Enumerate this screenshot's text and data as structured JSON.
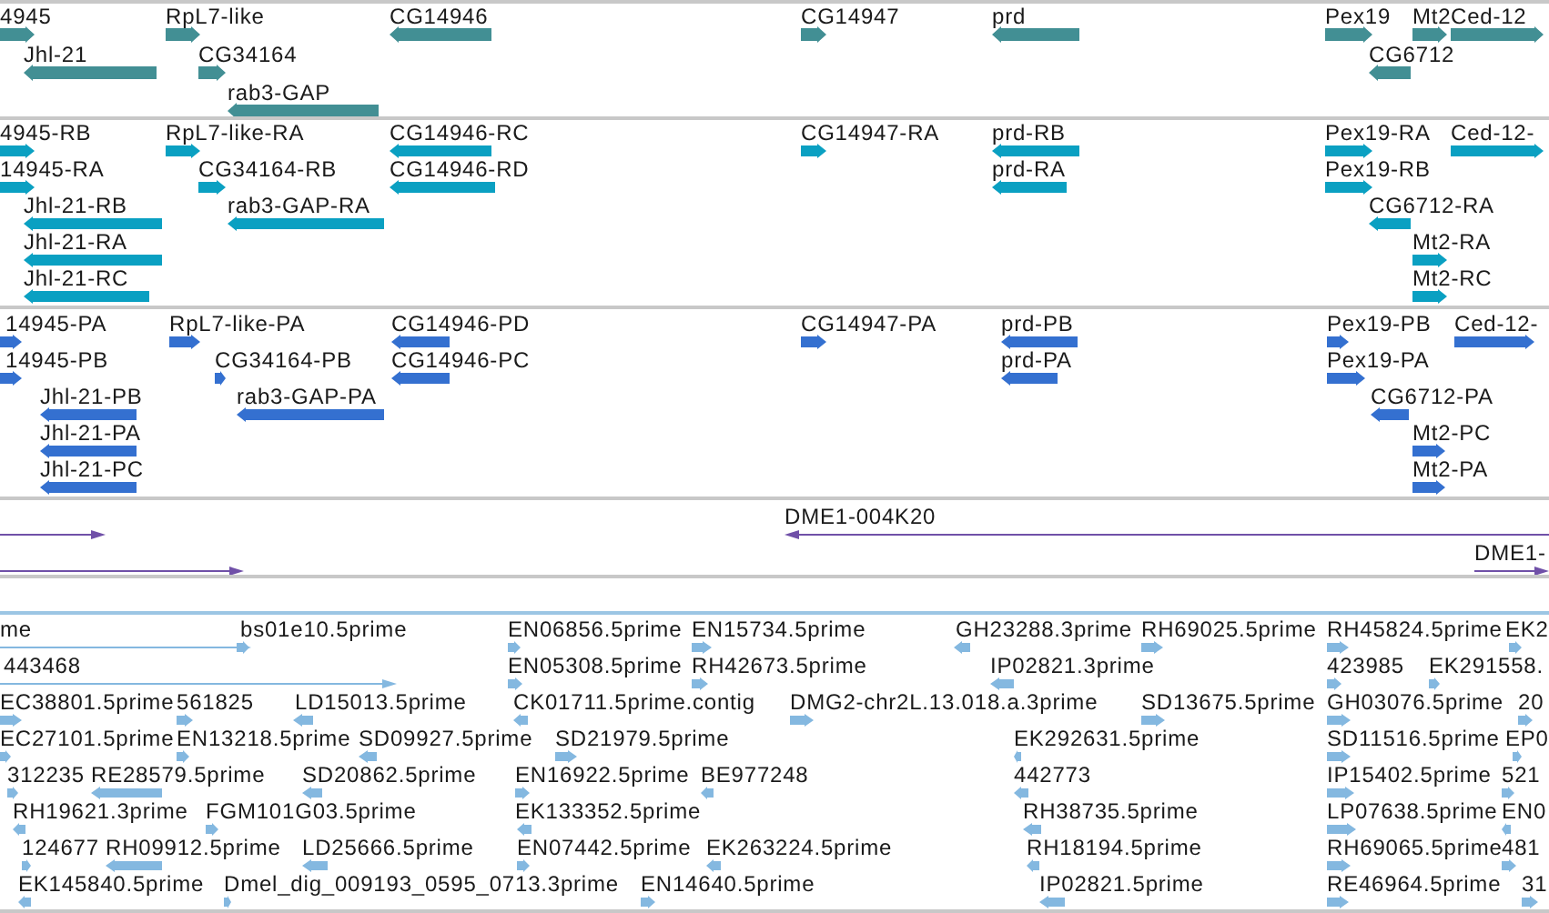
{
  "tracks": [
    {
      "kind": "genes",
      "features": [
        {
          "label": "4945",
          "reverse": false
        },
        {
          "label": "RpL7-like",
          "reverse": false
        },
        {
          "label": "CG14946",
          "reverse": true
        },
        {
          "label": "CG14947",
          "reverse": false
        },
        {
          "label": "prd",
          "reverse": true
        },
        {
          "label": "Pex19",
          "reverse": false
        },
        {
          "label": "Mt2",
          "reverse": false
        },
        {
          "label": "Ced-12",
          "reverse": false
        },
        {
          "label": "Jhl-21",
          "reverse": true
        },
        {
          "label": "CG34164",
          "reverse": false
        },
        {
          "label": "CG6712",
          "reverse": true
        },
        {
          "label": "rab3-GAP",
          "reverse": true
        }
      ]
    },
    {
      "kind": "transcripts",
      "features": [
        {
          "label": "4945-RB",
          "reverse": false
        },
        {
          "label": "RpL7-like-RA",
          "reverse": false
        },
        {
          "label": "CG14946-RC",
          "reverse": true
        },
        {
          "label": "CG14947-RA",
          "reverse": false
        },
        {
          "label": "prd-RB",
          "reverse": true
        },
        {
          "label": "Pex19-RA",
          "reverse": false
        },
        {
          "label": "Ced-12-",
          "reverse": false
        },
        {
          "label": "14945-RA",
          "reverse": false
        },
        {
          "label": "CG34164-RB",
          "reverse": false
        },
        {
          "label": "CG14946-RD",
          "reverse": true
        },
        {
          "label": "prd-RA",
          "reverse": true
        },
        {
          "label": "Pex19-RB",
          "reverse": false
        },
        {
          "label": "Jhl-21-RB",
          "reverse": true
        },
        {
          "label": "rab3-GAP-RA",
          "reverse": true
        },
        {
          "label": "CG6712-RA",
          "reverse": true
        },
        {
          "label": "Jhl-21-RA",
          "reverse": true
        },
        {
          "label": "Mt2-RA",
          "reverse": false
        },
        {
          "label": "Jhl-21-RC",
          "reverse": true
        },
        {
          "label": "Mt2-RC",
          "reverse": false
        }
      ]
    },
    {
      "kind": "proteins",
      "features": [
        {
          "label": "14945-PA",
          "reverse": false
        },
        {
          "label": "RpL7-like-PA",
          "reverse": false
        },
        {
          "label": "CG14946-PD",
          "reverse": true
        },
        {
          "label": "CG14947-PA",
          "reverse": false
        },
        {
          "label": "prd-PB",
          "reverse": true
        },
        {
          "label": "Pex19-PB",
          "reverse": false
        },
        {
          "label": "Ced-12-",
          "reverse": false
        },
        {
          "label": "14945-PB",
          "reverse": false
        },
        {
          "label": "CG34164-PB",
          "reverse": false
        },
        {
          "label": "CG14946-PC",
          "reverse": true
        },
        {
          "label": "prd-PA",
          "reverse": true
        },
        {
          "label": "Pex19-PA",
          "reverse": false
        },
        {
          "label": "Jhl-21-PB",
          "reverse": true
        },
        {
          "label": "rab3-GAP-PA",
          "reverse": true
        },
        {
          "label": "CG6712-PA",
          "reverse": true
        },
        {
          "label": "Jhl-21-PA",
          "reverse": true
        },
        {
          "label": "Mt2-PC",
          "reverse": false
        },
        {
          "label": "Jhl-21-PC",
          "reverse": true
        },
        {
          "label": "Mt2-PA",
          "reverse": false
        }
      ]
    },
    {
      "kind": "clones",
      "features": [
        {
          "reverse": false
        },
        {
          "label": "DME1-004K20",
          "reverse": true
        },
        {
          "reverse": false
        },
        {
          "label": "DME1-",
          "reverse": false
        }
      ]
    },
    {
      "kind": "ests",
      "features": [
        {
          "label": "me",
          "reverse": false
        },
        {
          "label": "bs01e10.5prime",
          "reverse": false
        },
        {
          "label": "EN06856.5prime",
          "reverse": false
        },
        {
          "label": "EN15734.5prime",
          "reverse": false
        },
        {
          "label": "GH23288.3prime",
          "reverse": true
        },
        {
          "label": "RH69025.5prime",
          "reverse": false
        },
        {
          "label": "RH45824.5prime",
          "reverse": false
        },
        {
          "label": "EK2",
          "reverse": false
        },
        {
          "label": "443468",
          "reverse": false
        },
        {
          "label": "EN05308.5prime",
          "reverse": false
        },
        {
          "label": "RH42673.5prime",
          "reverse": false
        },
        {
          "label": "IP02821.3prime",
          "reverse": true
        },
        {
          "label": "423985",
          "reverse": false
        },
        {
          "label": "EK291558.",
          "reverse": false
        },
        {
          "label": "EC38801.5prime",
          "reverse": false
        },
        {
          "label": "561825",
          "reverse": false
        },
        {
          "label": "LD15013.5prime",
          "reverse": true
        },
        {
          "label": "CK01711.5prime.contig",
          "reverse": true
        },
        {
          "label": "DMG2-chr2L.13.018.a.3prime",
          "reverse": false
        },
        {
          "label": "SD13675.5prime",
          "reverse": false
        },
        {
          "label": "GH03076.5prime",
          "reverse": false
        },
        {
          "label": "20",
          "reverse": false
        },
        {
          "label": "EC27101.5prime",
          "reverse": false
        },
        {
          "label": "EN13218.5prime",
          "reverse": false
        },
        {
          "label": "SD09927.5prime",
          "reverse": true
        },
        {
          "label": "SD21979.5prime",
          "reverse": false
        },
        {
          "label": "EK292631.5prime",
          "reverse": true
        },
        {
          "label": "SD11516.5prime",
          "reverse": false
        },
        {
          "label": "EP0",
          "reverse": false
        },
        {
          "label": "312235",
          "reverse": false
        },
        {
          "label": "RE28579.5prime",
          "reverse": true
        },
        {
          "label": "SD20862.5prime",
          "reverse": true
        },
        {
          "label": "EN16922.5prime",
          "reverse": false
        },
        {
          "label": "BE977248",
          "reverse": true
        },
        {
          "label": "442773",
          "reverse": true
        },
        {
          "label": "IP15402.5prime",
          "reverse": false
        },
        {
          "label": "521",
          "reverse": false
        },
        {
          "label": "RH19621.3prime",
          "reverse": true
        },
        {
          "label": "FGM101G03.5prime",
          "reverse": false
        },
        {
          "label": "EK133352.5prime",
          "reverse": true
        },
        {
          "label": "RH38735.5prime",
          "reverse": true
        },
        {
          "label": "LP07638.5prime",
          "reverse": false
        },
        {
          "label": "EN0",
          "reverse": true
        },
        {
          "label": "124677",
          "reverse": false
        },
        {
          "label": "RH09912.5prime",
          "reverse": true
        },
        {
          "label": "LD25666.5prime",
          "reverse": true
        },
        {
          "label": "EN07442.5prime",
          "reverse": false
        },
        {
          "label": "EK263224.5prime",
          "reverse": true
        },
        {
          "label": "RH18194.5prime",
          "reverse": true
        },
        {
          "label": "RH69065.5prime",
          "reverse": false
        },
        {
          "label": "481",
          "reverse": false
        },
        {
          "label": "EK145840.5prime",
          "reverse": true
        },
        {
          "label": "Dmel_dig_009193_0595_0713.3prime",
          "reverse": false
        },
        {
          "label": "EN14640.5prime",
          "reverse": false
        },
        {
          "label": "IP02821.5prime",
          "reverse": true
        },
        {
          "label": "RE46964.5prime",
          "reverse": false
        },
        {
          "label": "31",
          "reverse": false
        }
      ]
    }
  ]
}
